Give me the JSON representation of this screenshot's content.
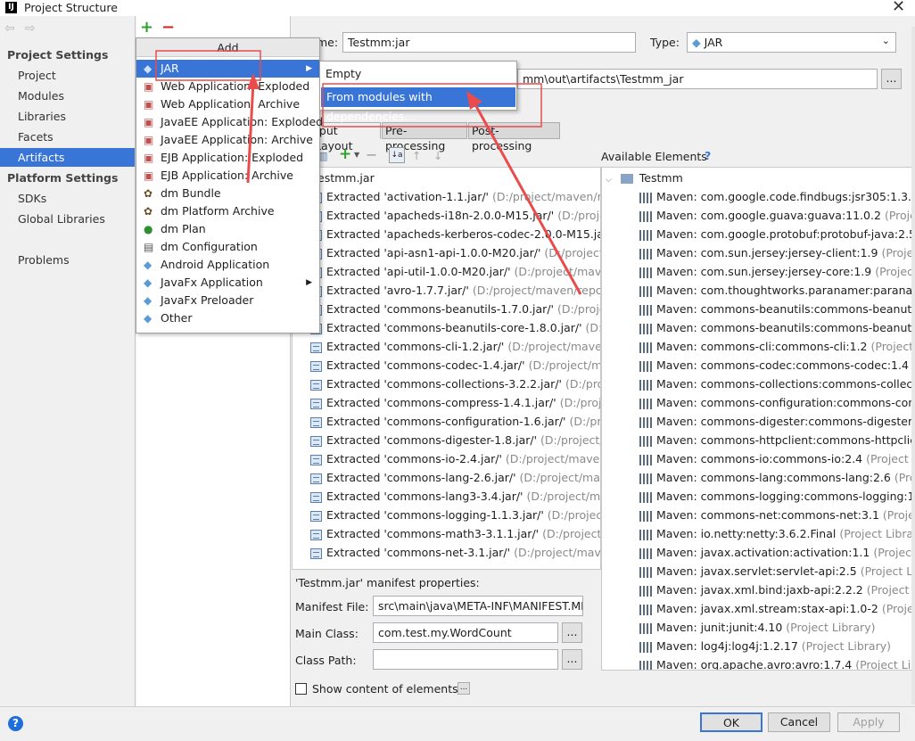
{
  "window": {
    "title": "Project Structure",
    "icon": "intellij-icon",
    "close": "✕"
  },
  "nav": {
    "back": "back-arrow-icon",
    "forward": "forward-arrow-icon"
  },
  "sidebar": {
    "project_settings": "Project Settings",
    "items": [
      {
        "label": "Project"
      },
      {
        "label": "Modules"
      },
      {
        "label": "Libraries"
      },
      {
        "label": "Facets"
      },
      {
        "label": "Artifacts",
        "selected": true
      }
    ],
    "platform_settings": "Platform Settings",
    "platform_items": [
      {
        "label": "SDKs"
      },
      {
        "label": "Global Libraries"
      }
    ],
    "problems": "Problems"
  },
  "artifact_list": {
    "add": "+",
    "remove": "−"
  },
  "add_popup": {
    "header": "Add",
    "items": [
      {
        "label": "JAR",
        "icon": "jar-diamond-icon",
        "selected": true,
        "submenu": true
      },
      {
        "label": "Web Application: Exploded",
        "icon": "web-app-icon"
      },
      {
        "label": "Web Application: Archive",
        "icon": "web-app-icon"
      },
      {
        "label": "JavaEE Application: Exploded",
        "icon": "javaee-icon"
      },
      {
        "label": "JavaEE Application: Archive",
        "icon": "javaee-icon"
      },
      {
        "label": "EJB Application: Exploded",
        "icon": "ejb-icon"
      },
      {
        "label": "EJB Application: Archive",
        "icon": "ejb-icon"
      },
      {
        "label": "dm Bundle",
        "icon": "dm-bundle-icon"
      },
      {
        "label": "dm Platform Archive",
        "icon": "dm-bundle-icon"
      },
      {
        "label": "dm Plan",
        "icon": "dm-plan-icon"
      },
      {
        "label": "dm Configuration",
        "icon": "dm-config-icon"
      },
      {
        "label": "Android Application",
        "icon": "android-diamond-icon"
      },
      {
        "label": "JavaFx Application",
        "icon": "javafx-diamond-icon",
        "submenu": true
      },
      {
        "label": "JavaFx Preloader",
        "icon": "javafx-diamond-icon"
      },
      {
        "label": "Other",
        "icon": "other-diamond-icon"
      }
    ]
  },
  "jar_submenu": {
    "items": [
      {
        "label": "Empty"
      },
      {
        "label": "From modules with dependencies...",
        "selected": true
      }
    ]
  },
  "form": {
    "name_label": "me:",
    "name_value": "Testmm:jar",
    "type_label": "Type:",
    "type_value": "JAR",
    "output_suffix": "mm\\out\\artifacts\\Testmm_jar",
    "browse": "..."
  },
  "tabs": [
    {
      "label": "tput Layout",
      "active": true
    },
    {
      "label": "Pre-processing"
    },
    {
      "label": "Post-processing"
    }
  ],
  "output_tree": {
    "root": "estmm.jar",
    "items": [
      {
        "name": "Extracted 'activation-1.1.jar/'",
        "path": "(D:/project/maven/repo"
      },
      {
        "name": "Extracted 'apacheds-i18n-2.0.0-M15.jar/'",
        "path": "(D:/project/"
      },
      {
        "name": "Extracted 'apacheds-kerberos-codec-2.0.0-M15.jar/'",
        "path": "(D:/"
      },
      {
        "name": "Extracted 'api-asn1-api-1.0.0-M20.jar/'",
        "path": "(D:/project/m"
      },
      {
        "name": "Extracted 'api-util-1.0.0-M20.jar/'",
        "path": "(D:/project/maven/r"
      },
      {
        "name": "Extracted 'avro-1.7.7.jar/'",
        "path": "(D:/project/maven/repo/or"
      },
      {
        "name": "Extracted 'commons-beanutils-1.7.0.jar/'",
        "path": "(D:/project/"
      },
      {
        "name": "Extracted 'commons-beanutils-core-1.8.0.jar/'",
        "path": "(D:/proj"
      },
      {
        "name": "Extracted 'commons-cli-1.2.jar/'",
        "path": "(D:/project/maven/re"
      },
      {
        "name": "Extracted 'commons-codec-1.4.jar/'",
        "path": "(D:/project/mave"
      },
      {
        "name": "Extracted 'commons-collections-3.2.2.jar/'",
        "path": "(D:/project"
      },
      {
        "name": "Extracted 'commons-compress-1.4.1.jar/'",
        "path": "(D:/project/"
      },
      {
        "name": "Extracted 'commons-configuration-1.6.jar/'",
        "path": "(D:/projec"
      },
      {
        "name": "Extracted 'commons-digester-1.8.jar/'",
        "path": "(D:/project/ma"
      },
      {
        "name": "Extracted 'commons-io-2.4.jar/'",
        "path": "(D:/project/maven/re"
      },
      {
        "name": "Extracted 'commons-lang-2.6.jar/'",
        "path": "(D:/project/maven"
      },
      {
        "name": "Extracted 'commons-lang3-3.4.jar/'",
        "path": "(D:/project/maven"
      },
      {
        "name": "Extracted 'commons-logging-1.1.3.jar/'",
        "path": "(D:/project/m"
      },
      {
        "name": "Extracted 'commons-math3-3.1.1.jar/'",
        "path": "(D:/project/ma"
      },
      {
        "name": "Extracted 'commons-net-3.1.jar/'",
        "path": "(D:/project/maven/r"
      }
    ]
  },
  "available": {
    "title": "Available Elements",
    "help": "?",
    "root": "Testmm",
    "items": [
      {
        "name": "Maven: com.google.code.findbugs:jsr305:1.3.9",
        "suffix": "(Project L"
      },
      {
        "name": "Maven: com.google.guava:guava:11.0.2",
        "suffix": "(Project Li"
      },
      {
        "name": "Maven: com.google.protobuf:protobuf-java:2.5.0",
        "suffix": ""
      },
      {
        "name": "Maven: com.sun.jersey:jersey-client:1.9",
        "suffix": "(Project Lib"
      },
      {
        "name": "Maven: com.sun.jersey:jersey-core:1.9",
        "suffix": "(Project Libr"
      },
      {
        "name": "Maven: com.thoughtworks.paranamer:paranamer",
        "suffix": ""
      },
      {
        "name": "Maven: commons-beanutils:commons-beanutils-co",
        "suffix": ""
      },
      {
        "name": "Maven: commons-beanutils:commons-beanutils:1",
        "suffix": ""
      },
      {
        "name": "Maven: commons-cli:commons-cli:1.2",
        "suffix": "(Project Lib"
      },
      {
        "name": "Maven: commons-codec:commons-codec:1.4",
        "suffix": "(Pr"
      },
      {
        "name": "Maven: commons-collections:commons-collection",
        "suffix": ""
      },
      {
        "name": "Maven: commons-configuration:commons-config",
        "suffix": ""
      },
      {
        "name": "Maven: commons-digester:commons-digester:1.8",
        "suffix": ""
      },
      {
        "name": "Maven: commons-httpclient:commons-httpclient:3",
        "suffix": ""
      },
      {
        "name": "Maven: commons-io:commons-io:2.4",
        "suffix": "(Project Lib"
      },
      {
        "name": "Maven: commons-lang:commons-lang:2.6",
        "suffix": "(Projec"
      },
      {
        "name": "Maven: commons-logging:commons-logging:1.1.",
        "suffix": ""
      },
      {
        "name": "Maven: commons-net:commons-net:3.1",
        "suffix": "(Project Lib"
      },
      {
        "name": "Maven: io.netty:netty:3.6.2.Final",
        "suffix": "(Project Library)"
      },
      {
        "name": "Maven: javax.activation:activation:1.1",
        "suffix": "(Project Libra"
      },
      {
        "name": "Maven: javax.servlet:servlet-api:2.5",
        "suffix": "(Project Librar"
      },
      {
        "name": "Maven: javax.xml.bind:jaxb-api:2.2.2",
        "suffix": "(Project Libra"
      },
      {
        "name": "Maven: javax.xml.stream:stax-api:1.0-2",
        "suffix": "(Project Lib"
      },
      {
        "name": "Maven: junit:junit:4.10",
        "suffix": "(Project Library)"
      },
      {
        "name": "Maven: log4j:log4j:1.2.17",
        "suffix": "(Project Library)"
      },
      {
        "name": "Maven: org.apache.avro:avro:1.7.4",
        "suffix": "(Project Librar"
      }
    ]
  },
  "manifest": {
    "title": "'Testmm.jar' manifest properties:",
    "file_label": "Manifest File:",
    "file_value": "src\\main\\java\\META-INF\\MANIFEST.MF",
    "main_label": "Main Class:",
    "main_value": "com.test.my.WordCount",
    "path_label": "Class Path:",
    "path_value": "",
    "browse": "...",
    "show_content": "Show content of elements",
    "show_btn": "..."
  },
  "buttons": {
    "help": "?",
    "ok": "OK",
    "cancel": "Cancel",
    "apply": "Apply"
  },
  "colors": {
    "selection": "#3875d7",
    "annotation": "#e84c4c"
  }
}
